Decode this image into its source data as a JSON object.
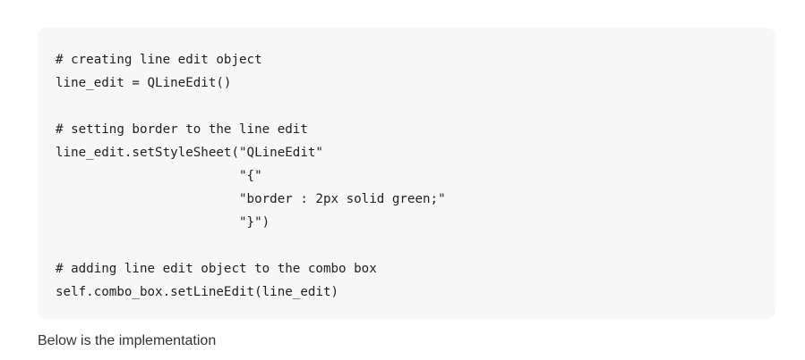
{
  "code": {
    "lines": [
      "# creating line edit object",
      "line_edit = QLineEdit()",
      "",
      "# setting border to the line edit",
      "line_edit.setStyleSheet(\"QLineEdit\"",
      "                        \"{\"",
      "                        \"border : 2px solid green;\"",
      "                        \"}\")",
      "",
      "# adding line edit object to the combo box",
      "self.combo_box.setLineEdit(line_edit)"
    ]
  },
  "caption": {
    "text": "Below is the implementation"
  }
}
